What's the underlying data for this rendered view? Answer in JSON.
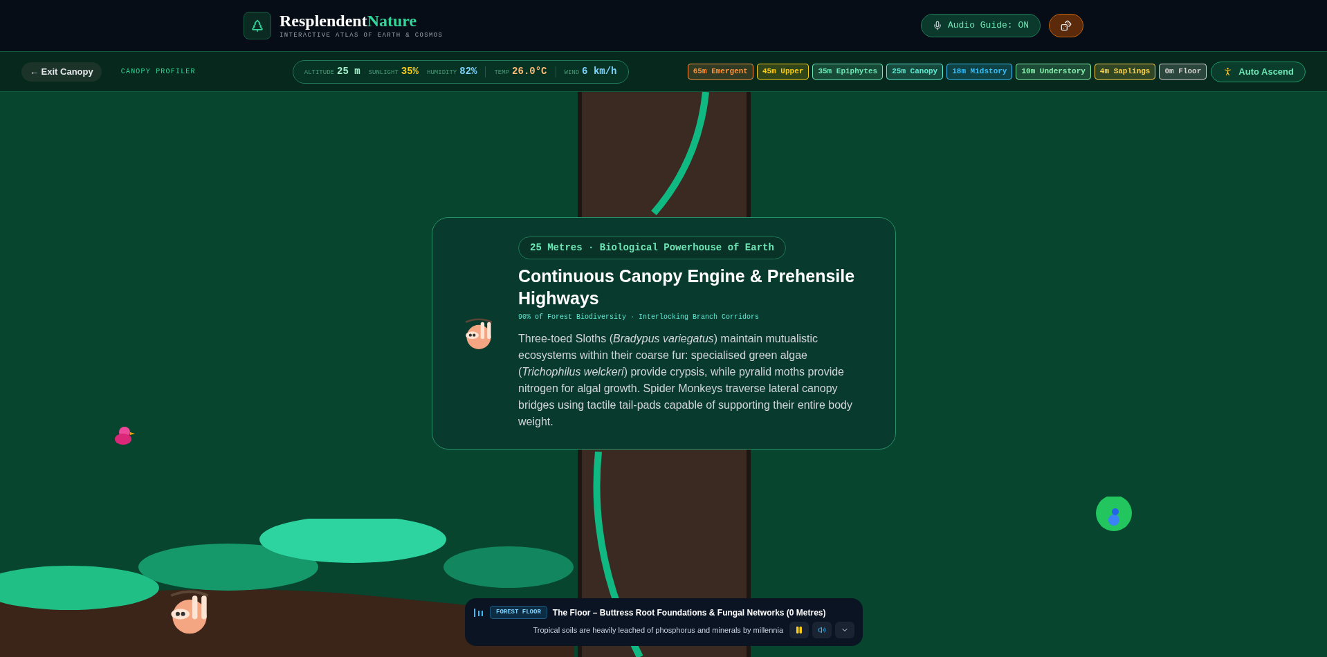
{
  "brand": {
    "name": "Resplendent",
    "name_accent": "Nature",
    "tagline": "INTERACTIVE ATLAS OF EARTH & COSMOS"
  },
  "header_actions": {
    "audio_guide": "Audio Guide: ON"
  },
  "nav": {
    "exit": "← Exit Canopy",
    "section": "CANOPY PROFILER",
    "stats": [
      {
        "label": "ALTITUDE",
        "value": "25 m",
        "color": "#a7f3d0",
        "divider": false
      },
      {
        "label": "SUNLIGHT",
        "value": "35%",
        "color": "#facc15",
        "divider": false
      },
      {
        "label": "HUMIDITY",
        "value": "82%",
        "color": "#7dd3fc",
        "divider": true
      },
      {
        "label": "TEMP",
        "value": "26.0°C",
        "color": "#fdba74",
        "divider": true
      },
      {
        "label": "WIND",
        "value": "6 km/h",
        "color": "#7dd3fc",
        "divider": false
      }
    ],
    "layers": [
      {
        "label": "65m Emergent",
        "color": "#fb923c"
      },
      {
        "label": "45m Upper",
        "color": "#facc15"
      },
      {
        "label": "35m Epiphytes",
        "color": "#6ee7b7"
      },
      {
        "label": "25m Canopy",
        "color": "#5eead4"
      },
      {
        "label": "18m Midstory",
        "color": "#38bdf8"
      },
      {
        "label": "10m Understory",
        "color": "#86efac"
      },
      {
        "label": "4m Saplings",
        "color": "#fcd34d"
      },
      {
        "label": "0m Floor",
        "color": "#d6d3d1"
      }
    ],
    "auto_ascend": "Auto Ascend"
  },
  "card": {
    "badge": "25 Metres · Biological Powerhouse of Earth",
    "title": "Continuous Canopy Engine & Prehensile Highways",
    "subtitle": "90% of Forest Biodiversity · Interlocking Branch Corridors",
    "body": "Three-toed Sloths (*Bradypus variegatus*) maintain mutualistic ecosystems within their coarse fur: specialised green algae (*Trichophilus welckeri*) provide crypsis, while pyralid moths provide nitrogen for algal growth. Spider Monkeys traverse lateral canopy bridges using tactile tail-pads capable of supporting their entire body weight."
  },
  "player": {
    "tag": "FOREST FLOOR",
    "title": "The Floor – Buttress Root Foundations & Fungal Networks (0 Metres)",
    "caption": "Tropical soils are heavily leached of phosphorus and minerals by millennia",
    "playing": true
  }
}
